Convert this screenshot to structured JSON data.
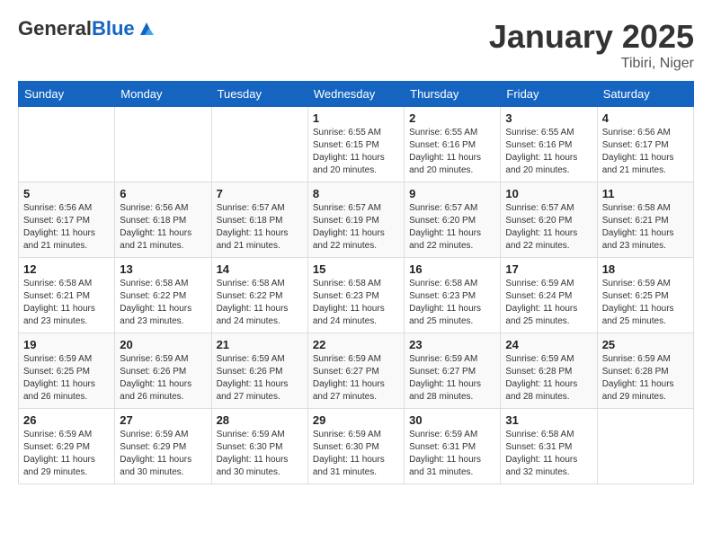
{
  "logo": {
    "general": "General",
    "blue": "Blue"
  },
  "title": "January 2025",
  "subtitle": "Tibiri, Niger",
  "days_of_week": [
    "Sunday",
    "Monday",
    "Tuesday",
    "Wednesday",
    "Thursday",
    "Friday",
    "Saturday"
  ],
  "weeks": [
    [
      {
        "day": "",
        "info": ""
      },
      {
        "day": "",
        "info": ""
      },
      {
        "day": "",
        "info": ""
      },
      {
        "day": "1",
        "info": "Sunrise: 6:55 AM\nSunset: 6:15 PM\nDaylight: 11 hours\nand 20 minutes."
      },
      {
        "day": "2",
        "info": "Sunrise: 6:55 AM\nSunset: 6:16 PM\nDaylight: 11 hours\nand 20 minutes."
      },
      {
        "day": "3",
        "info": "Sunrise: 6:55 AM\nSunset: 6:16 PM\nDaylight: 11 hours\nand 20 minutes."
      },
      {
        "day": "4",
        "info": "Sunrise: 6:56 AM\nSunset: 6:17 PM\nDaylight: 11 hours\nand 21 minutes."
      }
    ],
    [
      {
        "day": "5",
        "info": "Sunrise: 6:56 AM\nSunset: 6:17 PM\nDaylight: 11 hours\nand 21 minutes."
      },
      {
        "day": "6",
        "info": "Sunrise: 6:56 AM\nSunset: 6:18 PM\nDaylight: 11 hours\nand 21 minutes."
      },
      {
        "day": "7",
        "info": "Sunrise: 6:57 AM\nSunset: 6:18 PM\nDaylight: 11 hours\nand 21 minutes."
      },
      {
        "day": "8",
        "info": "Sunrise: 6:57 AM\nSunset: 6:19 PM\nDaylight: 11 hours\nand 22 minutes."
      },
      {
        "day": "9",
        "info": "Sunrise: 6:57 AM\nSunset: 6:20 PM\nDaylight: 11 hours\nand 22 minutes."
      },
      {
        "day": "10",
        "info": "Sunrise: 6:57 AM\nSunset: 6:20 PM\nDaylight: 11 hours\nand 22 minutes."
      },
      {
        "day": "11",
        "info": "Sunrise: 6:58 AM\nSunset: 6:21 PM\nDaylight: 11 hours\nand 23 minutes."
      }
    ],
    [
      {
        "day": "12",
        "info": "Sunrise: 6:58 AM\nSunset: 6:21 PM\nDaylight: 11 hours\nand 23 minutes."
      },
      {
        "day": "13",
        "info": "Sunrise: 6:58 AM\nSunset: 6:22 PM\nDaylight: 11 hours\nand 23 minutes."
      },
      {
        "day": "14",
        "info": "Sunrise: 6:58 AM\nSunset: 6:22 PM\nDaylight: 11 hours\nand 24 minutes."
      },
      {
        "day": "15",
        "info": "Sunrise: 6:58 AM\nSunset: 6:23 PM\nDaylight: 11 hours\nand 24 minutes."
      },
      {
        "day": "16",
        "info": "Sunrise: 6:58 AM\nSunset: 6:23 PM\nDaylight: 11 hours\nand 25 minutes."
      },
      {
        "day": "17",
        "info": "Sunrise: 6:59 AM\nSunset: 6:24 PM\nDaylight: 11 hours\nand 25 minutes."
      },
      {
        "day": "18",
        "info": "Sunrise: 6:59 AM\nSunset: 6:25 PM\nDaylight: 11 hours\nand 25 minutes."
      }
    ],
    [
      {
        "day": "19",
        "info": "Sunrise: 6:59 AM\nSunset: 6:25 PM\nDaylight: 11 hours\nand 26 minutes."
      },
      {
        "day": "20",
        "info": "Sunrise: 6:59 AM\nSunset: 6:26 PM\nDaylight: 11 hours\nand 26 minutes."
      },
      {
        "day": "21",
        "info": "Sunrise: 6:59 AM\nSunset: 6:26 PM\nDaylight: 11 hours\nand 27 minutes."
      },
      {
        "day": "22",
        "info": "Sunrise: 6:59 AM\nSunset: 6:27 PM\nDaylight: 11 hours\nand 27 minutes."
      },
      {
        "day": "23",
        "info": "Sunrise: 6:59 AM\nSunset: 6:27 PM\nDaylight: 11 hours\nand 28 minutes."
      },
      {
        "day": "24",
        "info": "Sunrise: 6:59 AM\nSunset: 6:28 PM\nDaylight: 11 hours\nand 28 minutes."
      },
      {
        "day": "25",
        "info": "Sunrise: 6:59 AM\nSunset: 6:28 PM\nDaylight: 11 hours\nand 29 minutes."
      }
    ],
    [
      {
        "day": "26",
        "info": "Sunrise: 6:59 AM\nSunset: 6:29 PM\nDaylight: 11 hours\nand 29 minutes."
      },
      {
        "day": "27",
        "info": "Sunrise: 6:59 AM\nSunset: 6:29 PM\nDaylight: 11 hours\nand 30 minutes."
      },
      {
        "day": "28",
        "info": "Sunrise: 6:59 AM\nSunset: 6:30 PM\nDaylight: 11 hours\nand 30 minutes."
      },
      {
        "day": "29",
        "info": "Sunrise: 6:59 AM\nSunset: 6:30 PM\nDaylight: 11 hours\nand 31 minutes."
      },
      {
        "day": "30",
        "info": "Sunrise: 6:59 AM\nSunset: 6:31 PM\nDaylight: 11 hours\nand 31 minutes."
      },
      {
        "day": "31",
        "info": "Sunrise: 6:58 AM\nSunset: 6:31 PM\nDaylight: 11 hours\nand 32 minutes."
      },
      {
        "day": "",
        "info": ""
      }
    ]
  ]
}
